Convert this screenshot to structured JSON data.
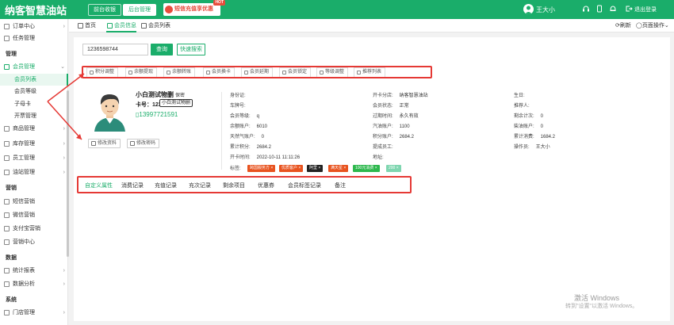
{
  "app": {
    "logo_text": "纳客智慧油站",
    "top_tabs": [
      "前台收银",
      "后台管理"
    ],
    "active_top_tab": 1,
    "promo": {
      "label": "短信充值享优惠",
      "badge": "HOT"
    },
    "user_name": "王大小",
    "logout_label": "退出登录"
  },
  "sidebar": {
    "items": [
      {
        "label": "订单中心",
        "arrow": "›"
      },
      {
        "label": "任务管理",
        "arrow": ""
      }
    ],
    "section_manage": "管理",
    "member_group": {
      "label": "会员管理",
      "arrow": "⌄"
    },
    "member_subs": [
      "会员列表",
      "会员等级",
      "子母卡",
      "开票管理"
    ],
    "items2": [
      {
        "label": "商品管理",
        "arrow": "›"
      },
      {
        "label": "库存管理",
        "arrow": "›"
      },
      {
        "label": "员工管理",
        "arrow": "›"
      },
      {
        "label": "油站管理",
        "arrow": "›"
      }
    ],
    "section_marketing": "营销",
    "marketing": [
      {
        "label": "短信营销"
      },
      {
        "label": "微信营销"
      },
      {
        "label": "支付宝营销"
      },
      {
        "label": "营销中心"
      }
    ],
    "section_data": "数据",
    "data_items": [
      {
        "label": "统计报表",
        "arrow": "›"
      },
      {
        "label": "数据分析",
        "arrow": "›"
      }
    ],
    "section_system": "系统",
    "system_items": [
      {
        "label": "门店管理",
        "arrow": "›"
      }
    ]
  },
  "page_tabs": {
    "home": "首页",
    "info": "会员信息",
    "list": "会员列表",
    "refresh": "刷新",
    "page_ops": "页面操作",
    "page_ops_arrow": "⌄"
  },
  "search": {
    "value": "1236598744",
    "query_btn": "查询",
    "quick_btn": "快速搜索"
  },
  "actions": [
    "积分调整",
    "余额提现",
    "余额转账",
    "会员换卡",
    "会员延期",
    "会员锁定",
    "等级调整",
    "推荐列表"
  ],
  "member": {
    "name": "小白测试物删",
    "secret": "保密",
    "card_label": "卡号：",
    "card_prefix": "123",
    "tooltip": "小白测试物删",
    "phone": "13997721591",
    "edit_btn": "修改资料",
    "pwd_btn": "修改密码",
    "col1": [
      {
        "label": "身份证:",
        "value": ""
      },
      {
        "label": "车牌号:",
        "value": ""
      },
      {
        "label": "会员等级:",
        "value": "q"
      },
      {
        "label": "余额账户:",
        "value": "6010"
      },
      {
        "label": "天然气账户:",
        "value": "0"
      },
      {
        "label": "累计积分:",
        "value": "2684.2"
      },
      {
        "label": "开卡时间:",
        "value": "2022-10-11 11:11:26"
      }
    ],
    "col2": [
      {
        "label": "开卡分店:",
        "value": "纳客智慧油站"
      },
      {
        "label": "会员状态:",
        "value": "正常"
      },
      {
        "label": "过期时间:",
        "value": "永久有效"
      },
      {
        "label": "汽油账户:",
        "value": "1100"
      },
      {
        "label": "积分账户:",
        "value": "2684.2"
      },
      {
        "label": "提成员工:",
        "value": ""
      },
      {
        "label": "地址:",
        "value": ""
      }
    ],
    "col3": [
      {
        "label": "生日:",
        "value": ""
      },
      {
        "label": "推荐人:",
        "value": ""
      },
      {
        "label": "剩余计次:",
        "value": "0"
      },
      {
        "label": "柴油账户:",
        "value": "0"
      },
      {
        "label": "累计消费:",
        "value": "1684.2"
      },
      {
        "label": "操作员:",
        "value": "王大小"
      }
    ],
    "tags_label": "标签:",
    "tags": [
      {
        "text": "跨国服务方",
        "color": "#e8531f"
      },
      {
        "text": "优质客户",
        "color": "#e8531f"
      },
      {
        "text": "阿里",
        "color": "#222222"
      },
      {
        "text": "满天星",
        "color": "#e8531f"
      },
      {
        "text": "100元消费",
        "color": "#2db84d"
      },
      {
        "text": "200",
        "color": "#7fd6b0"
      }
    ]
  },
  "sub_tabs": [
    "自定义属性",
    "消费记录",
    "充值记录",
    "充次记录",
    "剩余项目",
    "优惠券",
    "会员标签记录",
    "备注"
  ],
  "watermark": {
    "line1": "激活 Windows",
    "line2": "转到\"设置\"以激活 Windows。"
  }
}
